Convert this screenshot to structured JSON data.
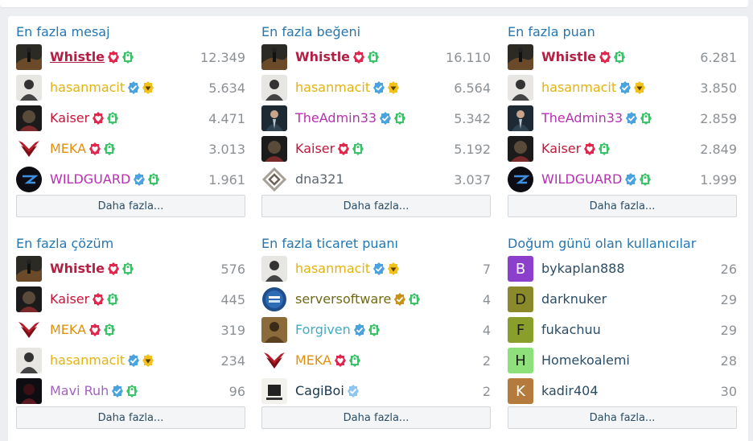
{
  "sections": [
    {
      "title": "En fazla mesaj",
      "rows": [
        {
          "name": "Whistle",
          "count": "12.349"
        },
        {
          "name": "hasanmacit",
          "count": "5.634"
        },
        {
          "name": "Kaiser",
          "count": "4.471"
        },
        {
          "name": "MEKA",
          "count": "3.013"
        },
        {
          "name": "WILDGUARD",
          "count": "1.961"
        }
      ],
      "more": "Daha fazla..."
    },
    {
      "title": "En fazla beğeni",
      "rows": [
        {
          "name": "Whistle",
          "count": "16.110"
        },
        {
          "name": "hasanmacit",
          "count": "6.564"
        },
        {
          "name": "TheAdmin33",
          "count": "5.342"
        },
        {
          "name": "Kaiser",
          "count": "5.192"
        },
        {
          "name": "dna321",
          "count": "3.037"
        }
      ],
      "more": "Daha fazla..."
    },
    {
      "title": "En fazla puan",
      "rows": [
        {
          "name": "Whistle",
          "count": "6.281"
        },
        {
          "name": "hasanmacit",
          "count": "3.850"
        },
        {
          "name": "TheAdmin33",
          "count": "2.859"
        },
        {
          "name": "Kaiser",
          "count": "2.849"
        },
        {
          "name": "WILDGUARD",
          "count": "1.999"
        }
      ],
      "more": "Daha fazla..."
    },
    {
      "title": "En fazla çözüm",
      "rows": [
        {
          "name": "Whistle",
          "count": "576"
        },
        {
          "name": "Kaiser",
          "count": "445"
        },
        {
          "name": "MEKA",
          "count": "319"
        },
        {
          "name": "hasanmacit",
          "count": "234"
        },
        {
          "name": "Mavi Ruh",
          "count": "96"
        }
      ],
      "more": "Daha fazla..."
    },
    {
      "title": "En fazla ticaret puanı",
      "rows": [
        {
          "name": "hasanmacit",
          "count": "7"
        },
        {
          "name": "serversoftware",
          "count": "4"
        },
        {
          "name": "Forgiven",
          "count": "4"
        },
        {
          "name": "MEKA",
          "count": "2"
        },
        {
          "name": "CagiBoi",
          "count": "2"
        }
      ],
      "more": "Daha fazla..."
    },
    {
      "title": "Doğum günü olan kullanıcılar",
      "rows": [
        {
          "name": "bykaplan888",
          "count": "26",
          "letter": "B"
        },
        {
          "name": "darknuker",
          "count": "29",
          "letter": "D"
        },
        {
          "name": "fukachuu",
          "count": "29",
          "letter": "F"
        },
        {
          "name": "Homekoalemi",
          "count": "28",
          "letter": "H"
        },
        {
          "name": "kadir404",
          "count": "30",
          "letter": "K"
        }
      ],
      "more": "Daha fazla..."
    }
  ],
  "colors": {
    "title": "#2577b1",
    "admin": "#b41f44",
    "gold_user": "#e2b30f",
    "red_user": "#c2173a",
    "orange_user": "#e0900d",
    "purple_user": "#a262c0",
    "magenta_user": "#b72fb2",
    "verified_badge": "#4aa3df",
    "heart_badge": "#e2264d",
    "shield_badge": "#3cc46a",
    "diamond_badge": "#f2c21b",
    "letter_b": "#8c3fcb",
    "letter_d": "#8a8a2a",
    "letter_f": "#8a9e2c",
    "letter_h": "#8ee07a",
    "letter_k": "#b57b3c"
  },
  "icons": [
    "heart-badge-icon",
    "shield-lock-icon",
    "verified-check-icon",
    "diamond-badge-icon",
    "gold-check-icon"
  ]
}
